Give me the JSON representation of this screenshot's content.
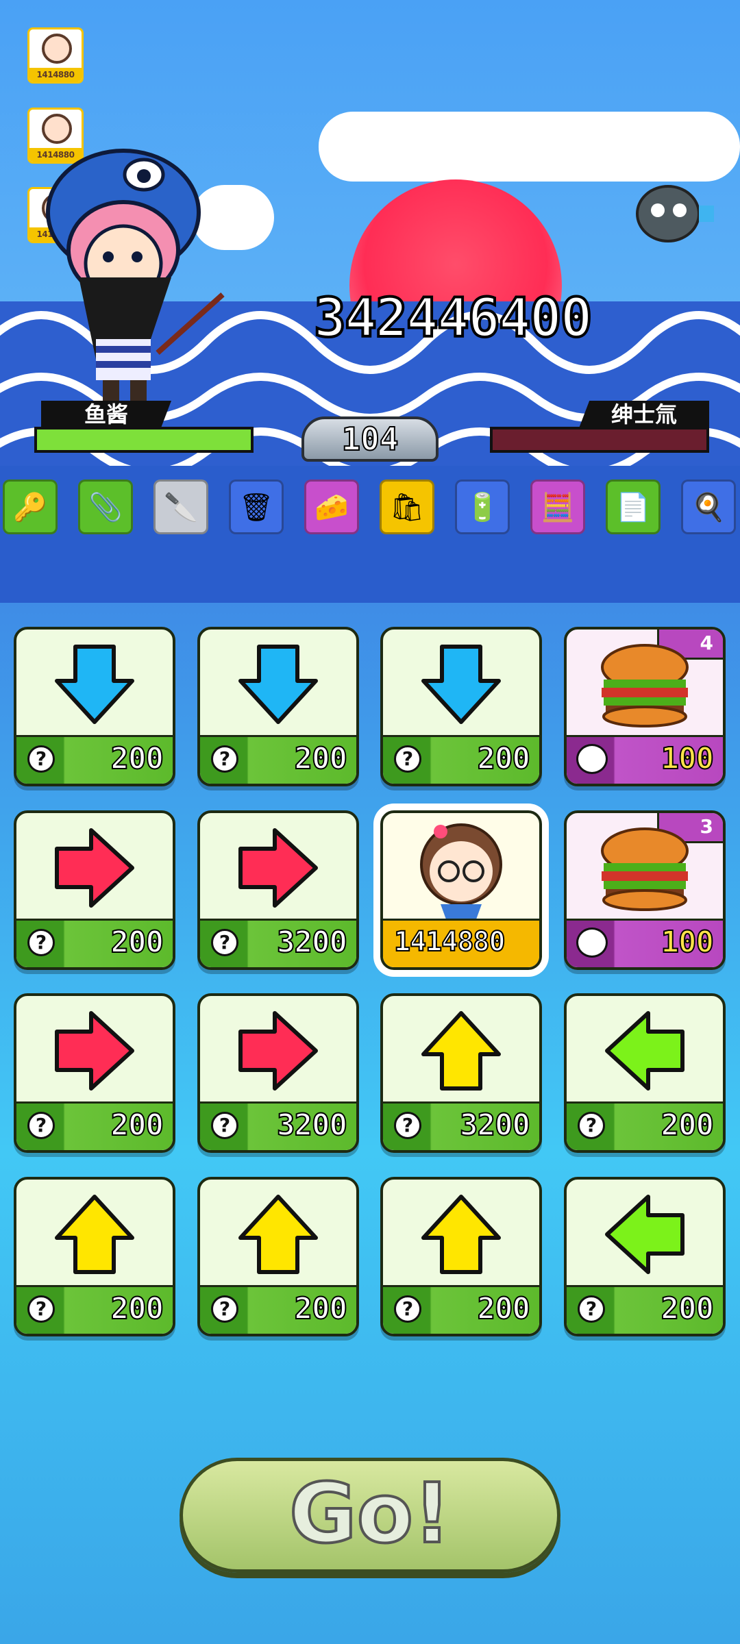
{
  "score": "342446400",
  "level": "104",
  "player": {
    "name": "鱼酱"
  },
  "opponent": {
    "name": "绅士氚"
  },
  "left_avatars": [
    {
      "label": "1414880"
    },
    {
      "label": "1414880"
    },
    {
      "label": "1414880"
    }
  ],
  "items": [
    "key-icon",
    "stapler-icon",
    "cleaver-icon",
    "trash-can-icon",
    "cheese-icon",
    "paper-bag-icon",
    "battery-icon",
    "calculator-icon",
    "document-icon",
    "frying-pan-icon"
  ],
  "grid": [
    [
      {
        "type": "arrow",
        "dir": "down",
        "color": "#1fb6f5",
        "price": "200"
      },
      {
        "type": "arrow",
        "dir": "down",
        "color": "#1fb6f5",
        "price": "200"
      },
      {
        "type": "arrow",
        "dir": "down",
        "color": "#1fb6f5",
        "price": "200"
      },
      {
        "type": "food",
        "count": "4",
        "price": "100"
      }
    ],
    [
      {
        "type": "arrow",
        "dir": "right",
        "color": "#ff2d55",
        "price": "200"
      },
      {
        "type": "arrow",
        "dir": "right",
        "color": "#ff2d55",
        "price": "3200"
      },
      {
        "type": "special",
        "label": "1414880"
      },
      {
        "type": "food",
        "count": "3",
        "price": "100"
      }
    ],
    [
      {
        "type": "arrow",
        "dir": "right",
        "color": "#ff2d55",
        "price": "200"
      },
      {
        "type": "arrow",
        "dir": "right",
        "color": "#ff2d55",
        "price": "3200"
      },
      {
        "type": "arrow",
        "dir": "up",
        "color": "#ffe600",
        "price": "3200"
      },
      {
        "type": "arrow",
        "dir": "left",
        "color": "#7cf21a",
        "price": "200"
      }
    ],
    [
      {
        "type": "arrow",
        "dir": "up",
        "color": "#ffe600",
        "price": "200"
      },
      {
        "type": "arrow",
        "dir": "up",
        "color": "#ffe600",
        "price": "200"
      },
      {
        "type": "arrow",
        "dir": "up",
        "color": "#ffe600",
        "price": "200"
      },
      {
        "type": "arrow",
        "dir": "left",
        "color": "#7cf21a",
        "price": "200"
      }
    ]
  ],
  "go_label": "Go!",
  "colors": {
    "hp_player": "#7ee03a",
    "hp_opponent": "#6a1e2e"
  }
}
